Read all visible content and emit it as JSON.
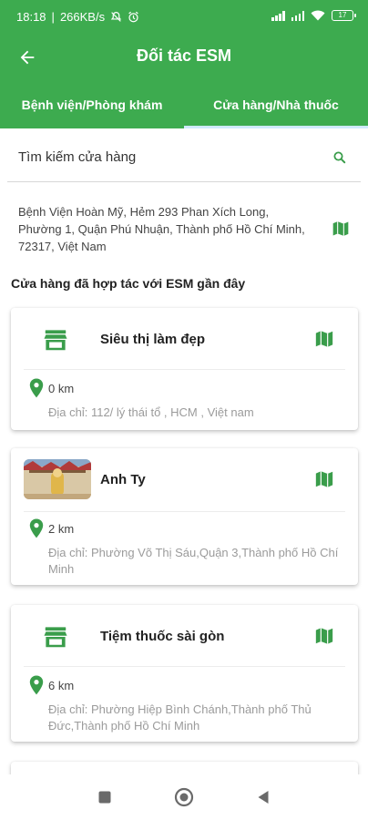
{
  "status_bar": {
    "time": "18:18",
    "net_speed": "266KB/s",
    "battery": "17"
  },
  "appbar": {
    "title": "Đối tác ESM"
  },
  "tabs": [
    {
      "label": "Bệnh viện/Phòng khám",
      "active": false
    },
    {
      "label": "Cửa hàng/Nhà thuốc",
      "active": true
    }
  ],
  "search": {
    "placeholder": "Tìm kiếm cửa hàng",
    "value": ""
  },
  "location": {
    "address": "Bệnh Viện Hoàn Mỹ, Hẻm 293 Phan Xích Long, Phường 1, Quận Phú Nhuận, Thành phố Hồ Chí Minh, 72317, Việt Nam"
  },
  "section": {
    "title": "Cửa hàng đã hợp tác với ESM gần đây"
  },
  "stores": [
    {
      "name": "Siêu thị làm đẹp",
      "distance": "0 km",
      "address": "Địa chỉ: 112/ lý thái tổ , HCM , Việt nam",
      "icon": "store-icon"
    },
    {
      "name": "Anh Ty",
      "distance": "2 km",
      "address": "Địa chỉ: Phường Võ Thị Sáu,Quận 3,Thành phố Hồ Chí Minh",
      "icon": "store-photo"
    },
    {
      "name": "Tiệm thuốc sài gòn",
      "distance": "6 km",
      "address": "Địa chỉ: Phường Hiệp Bình Chánh,Thành phố Thủ Đức,Thành phố Hồ Chí Minh",
      "icon": "store-icon"
    }
  ],
  "colors": {
    "primary": "#3dab4f",
    "accent": "#3a9d4b",
    "tab_indicator": "#cfe9ff"
  }
}
